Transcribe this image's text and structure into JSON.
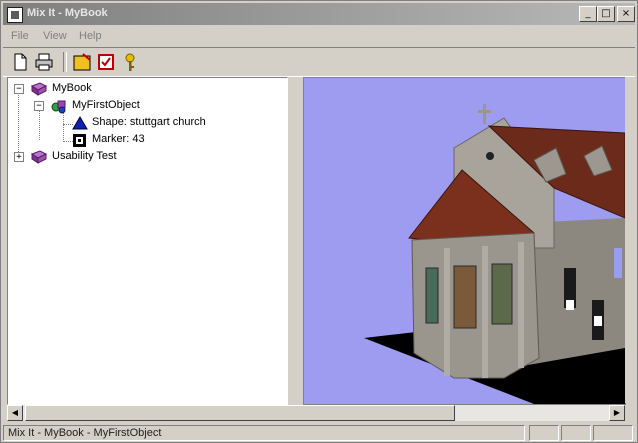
{
  "window": {
    "title": "Mix It - MyBook",
    "min": "_",
    "max": "□",
    "close": "×"
  },
  "menu": {
    "items": [
      "File",
      "View",
      "Help"
    ]
  },
  "toolbar": {
    "buttons": [
      "new-icon",
      "print-icon",
      "open-folder-icon",
      "checklist-icon",
      "key-icon"
    ]
  },
  "tree": {
    "nodes": [
      {
        "label": "MyBook",
        "icon": "book-icon",
        "expander": "−"
      },
      {
        "label": "MyFirstObject",
        "icon": "object-icon",
        "expander": "−"
      },
      {
        "label": "Shape: stuttgart church",
        "icon": "shape-icon"
      },
      {
        "label": "Marker: 43",
        "icon": "marker-icon"
      },
      {
        "label": "Usability Test",
        "icon": "book-icon",
        "expander": "+"
      }
    ]
  },
  "view": {
    "background": "#9e9cf0",
    "content": "3d-church-model"
  },
  "status": {
    "text": "Mix It - MyBook - MyFirstObject"
  }
}
